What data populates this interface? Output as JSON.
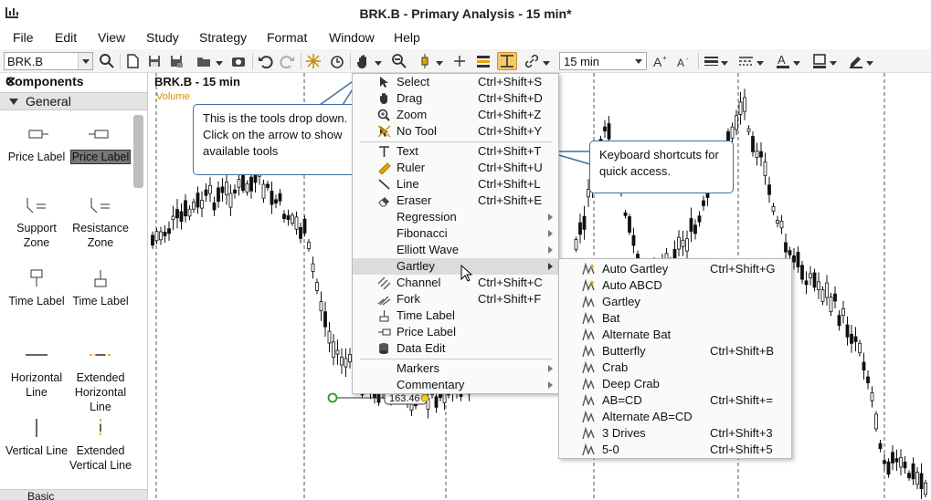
{
  "window": {
    "title": "BRK.B - Primary Analysis - 15 min*"
  },
  "menubar": [
    "File",
    "Edit",
    "View",
    "Study",
    "Strategy",
    "Format",
    "Window",
    "Help"
  ],
  "toolbar": {
    "symbol_value": "BRK.B",
    "interval_value": "15 min"
  },
  "components": {
    "title": "Components",
    "close_glyph": "✕",
    "group_general": "General",
    "group_basic": "Basic",
    "items": [
      "Price Label",
      "Price Label",
      "Support Zone",
      "Resistance Zone",
      "Time Label",
      "Time Label",
      "Horizontal Line",
      "Extended Horizontal Line",
      "Vertical Line",
      "Extended Vertical Line"
    ]
  },
  "chart": {
    "title": "BRK.B - 15 min",
    "volume_label": "Volume",
    "price_tag": "163.46"
  },
  "callouts": {
    "tools": "This is the tools drop down.  Click on the arrow to show available tools",
    "shortcuts": "Keyboard shortcuts for quick access."
  },
  "tools_menu": [
    {
      "label": "Select",
      "shortcut": "Ctrl+Shift+S",
      "icon": "cursor-arrow-icon"
    },
    {
      "label": "Drag",
      "shortcut": "Ctrl+Shift+D",
      "icon": "hand-icon"
    },
    {
      "label": "Zoom",
      "shortcut": "Ctrl+Shift+Z",
      "icon": "magnifier-icon"
    },
    {
      "label": "No Tool",
      "shortcut": "Ctrl+Shift+Y",
      "icon": "no-tool-icon"
    },
    {
      "label": "Text",
      "shortcut": "Ctrl+Shift+T",
      "icon": "text-t-icon"
    },
    {
      "label": "Ruler",
      "shortcut": "Ctrl+Shift+U",
      "icon": "ruler-icon"
    },
    {
      "label": "Line",
      "shortcut": "Ctrl+Shift+L",
      "icon": "line-icon"
    },
    {
      "label": "Eraser",
      "shortcut": "Ctrl+Shift+E",
      "icon": "eraser-icon"
    },
    {
      "label": "Regression",
      "shortcut": "",
      "icon": ""
    },
    {
      "label": "Fibonacci",
      "shortcut": "",
      "icon": ""
    },
    {
      "label": "Elliott Wave",
      "shortcut": "",
      "icon": ""
    },
    {
      "label": "Gartley",
      "shortcut": "",
      "icon": ""
    },
    {
      "label": "Channel",
      "shortcut": "Ctrl+Shift+C",
      "icon": "channel-icon"
    },
    {
      "label": "Fork",
      "shortcut": "Ctrl+Shift+F",
      "icon": "fork-icon"
    },
    {
      "label": "Time Label",
      "shortcut": "",
      "icon": "time-label-icon"
    },
    {
      "label": "Price Label",
      "shortcut": "",
      "icon": "price-label-icon"
    },
    {
      "label": "Data Edit",
      "shortcut": "",
      "icon": "data-edit-icon"
    },
    {
      "label": "Markers",
      "shortcut": "",
      "icon": ""
    },
    {
      "label": "Commentary",
      "shortcut": "",
      "icon": ""
    }
  ],
  "gartley_menu": [
    {
      "label": "Auto Gartley",
      "shortcut": "Ctrl+Shift+G"
    },
    {
      "label": "Auto ABCD",
      "shortcut": ""
    },
    {
      "label": "Gartley",
      "shortcut": ""
    },
    {
      "label": "Bat",
      "shortcut": ""
    },
    {
      "label": "Alternate Bat",
      "shortcut": ""
    },
    {
      "label": "Butterfly",
      "shortcut": "Ctrl+Shift+B"
    },
    {
      "label": "Crab",
      "shortcut": ""
    },
    {
      "label": "Deep Crab",
      "shortcut": ""
    },
    {
      "label": "AB=CD",
      "shortcut": "Ctrl+Shift+="
    },
    {
      "label": "Alternate AB=CD",
      "shortcut": ""
    },
    {
      "label": "3 Drives",
      "shortcut": "Ctrl+Shift+3"
    },
    {
      "label": "5-0",
      "shortcut": "Ctrl+Shift+5"
    }
  ],
  "colors": {
    "accent": "#f5c86a",
    "callout_border": "#3c6fa6",
    "volume_label": "#d98a00",
    "candle": "#000000"
  }
}
